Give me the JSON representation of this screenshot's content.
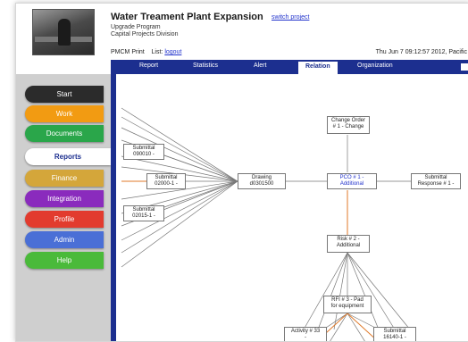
{
  "header": {
    "title": "Water Treament Plant Expansion",
    "switch_link": "switch project",
    "program": "Upgrade Program",
    "division": "Capital Projects Division",
    "user_label": "PMCM Print",
    "list_label": "List:",
    "logout_link": "logout",
    "datetime": "Thu Jun 7 09:12:57 2012, Pacific"
  },
  "tabs": [
    {
      "label": "Report"
    },
    {
      "label": "Statistics"
    },
    {
      "label": "Alert"
    },
    {
      "label": "Relation",
      "active": true
    },
    {
      "label": "Organization"
    }
  ],
  "sidebar": {
    "items": [
      {
        "label": "Start",
        "color": "#2b2b2b"
      },
      {
        "label": "Work",
        "color": "#f29b12"
      },
      {
        "label": "Documents",
        "color": "#2aa64a"
      },
      {
        "label": "Reports",
        "color": "#ffffff",
        "active": true
      },
      {
        "label": "Finance",
        "color": "#d4a63a"
      },
      {
        "label": "Integration",
        "color": "#8a2bbd"
      },
      {
        "label": "Profile",
        "color": "#e23b2e"
      },
      {
        "label": "Admin",
        "color": "#4a6fd6"
      },
      {
        "label": "Help",
        "color": "#4aba3a"
      }
    ]
  },
  "graph": {
    "nodes": {
      "submittal_090010": {
        "line1": "Submittal",
        "line2": "090010 -"
      },
      "submittal_02000": {
        "line1": "Submittal",
        "line2": "02000-1 -"
      },
      "submittal_0201": {
        "line1": "Submittal",
        "line2": "02015-1 -"
      },
      "drawing": {
        "line1": "Drawing",
        "line2": "d0301500"
      },
      "change_order": {
        "line1": "Change Order",
        "line2": "# 1 - Change"
      },
      "pco": {
        "line1": "PCO # 1 -",
        "line2": "Additional"
      },
      "submittal_response": {
        "line1": "Submittal",
        "line2": "Response # 1 -"
      },
      "risk": {
        "line1": "Risk # 2 -",
        "line2": "Additional"
      },
      "rfi": {
        "line1": "RFI # 3 - Pad",
        "line2": "for equipment"
      },
      "activity": {
        "line1": "Activity # 33",
        "line2": "-"
      },
      "submittal_16140": {
        "line1": "Submittal",
        "line2": "16140-1 -"
      }
    },
    "colors": {
      "edge": "#777777",
      "highlight_edge": "#e07a2a",
      "node_border": "#777777"
    }
  },
  "colors": {
    "accent": "#1c2f8f",
    "link": "#2233cc"
  }
}
